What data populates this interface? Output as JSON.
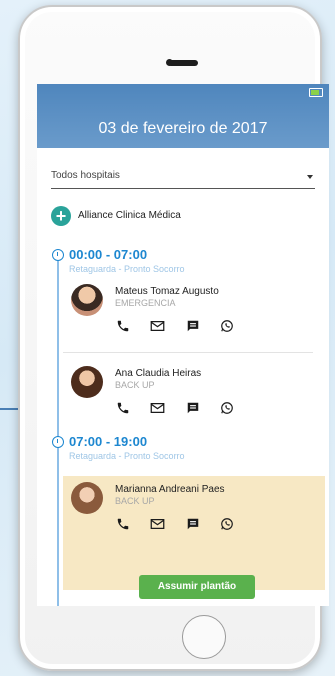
{
  "header": {
    "title": "03 de fevereiro de 2017"
  },
  "filter": {
    "selected": "Todos hospitais"
  },
  "hospital": {
    "name": "Alliance Clinica Médica"
  },
  "shifts": [
    {
      "time": "00:00 - 07:00",
      "subtitle": "Retaguarda - Pronto Socorro",
      "people": [
        {
          "name": "Mateus Tomaz Augusto",
          "role": "EMERGENCIA"
        },
        {
          "name": "Ana Claudia Heiras",
          "role": "BACK UP"
        }
      ]
    },
    {
      "time": "07:00 - 19:00",
      "subtitle": "Retaguarda - Pronto Socorro",
      "people": [
        {
          "name": "Marianna Andreani Paes",
          "role": "BACK UP",
          "action": "Assumir plantão"
        }
      ]
    }
  ],
  "contact_icons": [
    "phone-icon",
    "mail-icon",
    "chat-icon",
    "whatsapp-icon"
  ],
  "colors": {
    "accent": "#1d87d0",
    "header": "#5a8fc4",
    "highlight": "#f7e8c4",
    "button": "#5ab14d"
  }
}
